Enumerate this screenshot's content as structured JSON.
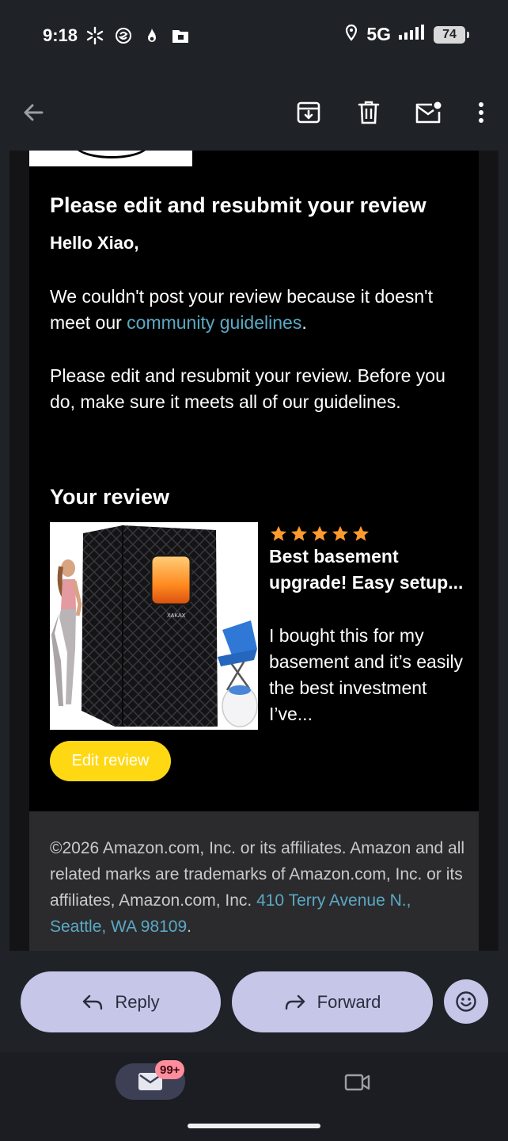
{
  "status_bar": {
    "time": "9:18",
    "network": "5G",
    "battery": "74"
  },
  "email": {
    "headline": "Please edit and resubmit your review",
    "greeting": "Hello Xiao,",
    "para1_before_link": "We couldn't post your review because it doesn't meet our ",
    "para1_link": "community guidelines",
    "para1_after_link": ".",
    "para2": "Please edit and resubmit your review. Before you do, make sure it meets all of our guidelines.",
    "review_section_title": "Your review",
    "review": {
      "rating": 5,
      "rating_max": 5,
      "heading": "Best basement upgrade! Easy setup...",
      "body": "I bought this for my basement and it’s easily the best investment I’ve...",
      "product_label": "XAKAX"
    },
    "edit_button": "Edit review",
    "footer_text": "©2026 Amazon.com, Inc. or its affiliates. Amazon and all related marks are trademarks of Amazon.com, Inc. or its affiliates, Amazon.com, Inc. ",
    "footer_link": "410 Terry Avenue N., Seattle, WA 98109",
    "footer_end": "."
  },
  "actions": {
    "reply": "Reply",
    "forward": "Forward"
  },
  "bottom_nav": {
    "mail_badge": "99+"
  },
  "colors": {
    "accent_yellow": "#ffd814",
    "link": "#5aa9c4",
    "pill": "#c5c6e8",
    "star": "#ff9a2e"
  }
}
